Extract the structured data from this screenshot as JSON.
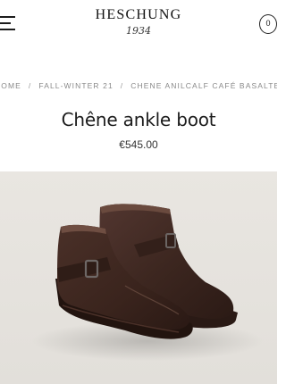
{
  "header": {
    "brand": "HESCHUNG",
    "brand_sub": "1934",
    "cart_count": "0"
  },
  "breadcrumb": {
    "items": [
      "HOME",
      "FALL-WINTER 21",
      "CHENE ANILCALF CAFÉ BASALTE"
    ],
    "separator": "/"
  },
  "product": {
    "title": "Chêne ankle boot",
    "price": "€545.00"
  },
  "icons": {
    "menu": "hamburger-menu-icon",
    "cart": "cart-bubble-icon"
  },
  "colors": {
    "text": "#1c1c1c",
    "breadcrumb": "#8a8a8a",
    "image_bg": "#e6e3de",
    "leather": "#3b2620"
  }
}
